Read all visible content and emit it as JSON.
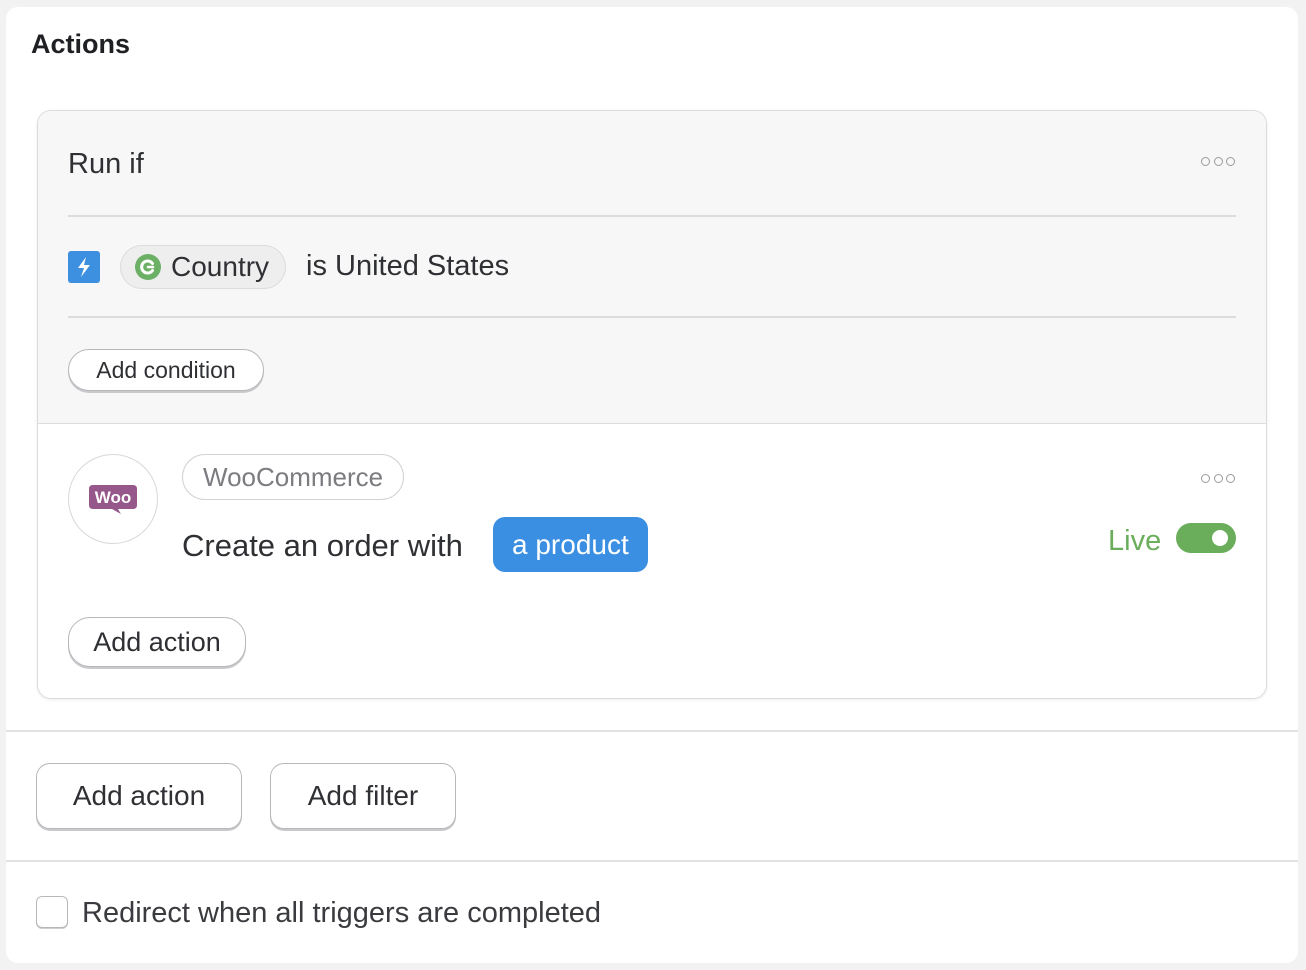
{
  "panel": {
    "title": "Actions"
  },
  "condition_block": {
    "title": "Run if",
    "condition": {
      "field": "Country",
      "text": "is United States"
    },
    "add_condition_label": "Add condition"
  },
  "action_block": {
    "app_tag": "WooCommerce",
    "logo_text": "Woo",
    "action_text": "Create an order with",
    "product_chip": "a product",
    "status_label": "Live",
    "status_enabled": true,
    "add_action_label": "Add action"
  },
  "footer_buttons": {
    "add_action_label": "Add action",
    "add_filter_label": "Add filter"
  },
  "redirect": {
    "label": "Redirect when all triggers are completed",
    "checked": false
  },
  "colors": {
    "accent_blue": "#3a8fe2",
    "live_green": "#6aad5b",
    "woo_purple": "#96588a"
  },
  "icons": {
    "menu": "more-horizontal-icon",
    "trigger": "lightning-bolt-icon",
    "field": "circle-c-icon",
    "app": "woocommerce-logo-icon"
  }
}
